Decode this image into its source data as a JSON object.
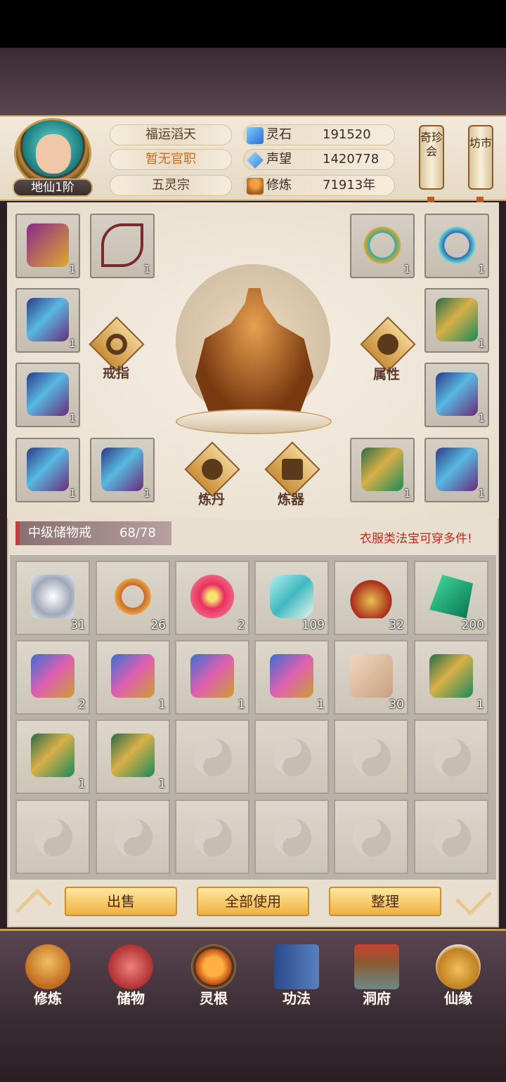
{
  "player": {
    "rank": "地仙1阶",
    "title": "福运滔天",
    "office": "暂无官职",
    "sect": "五灵宗"
  },
  "resources": [
    {
      "icon": "spirit-stone-icon",
      "name": "灵石",
      "value": "191520"
    },
    {
      "icon": "reputation-icon",
      "name": "声望",
      "value": "1420778"
    },
    {
      "icon": "cultivation-icon",
      "name": "修炼",
      "value": "71913年"
    }
  ],
  "shortcuts": {
    "treasure": "奇珍会",
    "market": "坊市"
  },
  "equip_slots": [
    {
      "icon": "boots-icon",
      "count": "1"
    },
    {
      "icon": "bow-icon",
      "count": "1"
    },
    {
      "icon": "gold-ring-icon",
      "count": "1"
    },
    {
      "icon": "blue-ring-icon",
      "count": "1"
    },
    {
      "icon": "blue-robe-icon",
      "count": "1"
    },
    {
      "icon": "green-armor-icon",
      "count": "1"
    },
    {
      "icon": "blue-robe-icon",
      "count": "1"
    },
    {
      "icon": "blue-robe-icon",
      "count": "1"
    },
    {
      "icon": "blue-robe-icon",
      "count": "1"
    },
    {
      "icon": "blue-robe-icon",
      "count": "1"
    },
    {
      "icon": "green-armor-icon",
      "count": "1"
    },
    {
      "icon": "blue-robe-icon",
      "count": "1"
    }
  ],
  "actions": {
    "ring": "戒指",
    "attributes": "属性",
    "alchemy": "炼丹",
    "forge": "炼器"
  },
  "bag": {
    "name": "中级储物戒",
    "capacity": "68/78",
    "hint": "衣服类法宝可穿多件!"
  },
  "items": [
    {
      "icon": "silver-orb-icon",
      "count": "31"
    },
    {
      "icon": "gold-ring-icon",
      "count": "26"
    },
    {
      "icon": "lotus-icon",
      "count": "2"
    },
    {
      "icon": "jade-cloud-icon",
      "count": "109"
    },
    {
      "icon": "teapot-icon",
      "count": "32"
    },
    {
      "icon": "green-crystal-icon",
      "count": "200"
    },
    {
      "icon": "scroll-icon",
      "count": "2"
    },
    {
      "icon": "scroll-icon",
      "count": "1"
    },
    {
      "icon": "scroll-icon",
      "count": "1"
    },
    {
      "icon": "scroll-icon",
      "count": "1"
    },
    {
      "icon": "paper-scroll-icon",
      "count": "30"
    },
    {
      "icon": "green-armor-icon",
      "count": "1"
    },
    {
      "icon": "green-armor-icon",
      "count": "1"
    },
    {
      "icon": "green-armor-icon",
      "count": "1"
    }
  ],
  "buttons": {
    "sell": "出售",
    "use_all": "全部使用",
    "sort": "整理"
  },
  "nav": [
    {
      "icon": "cultivate-icon",
      "label": "修炼"
    },
    {
      "icon": "storage-bag-icon",
      "label": "储物"
    },
    {
      "icon": "spirit-root-icon",
      "label": "灵根"
    },
    {
      "icon": "technique-book-icon",
      "label": "功法"
    },
    {
      "icon": "cave-mansion-icon",
      "label": "洞府"
    },
    {
      "icon": "immortal-fate-icon",
      "label": "仙缘"
    }
  ]
}
